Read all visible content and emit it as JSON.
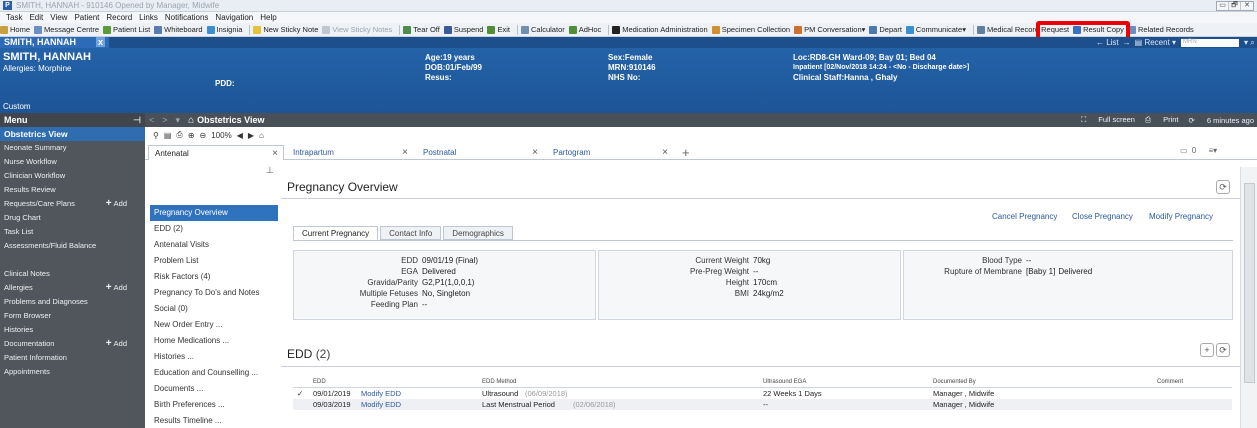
{
  "window": {
    "title": "SMITH, HANNAH - 910146 Opened by Manager, Midwife",
    "app_letter": "P",
    "controls": [
      "▭",
      "🗗",
      "✕"
    ]
  },
  "menubar": [
    "Task",
    "Edit",
    "View",
    "Patient",
    "Record",
    "Links",
    "Notifications",
    "Navigation",
    "Help"
  ],
  "toolbar": [
    {
      "label": "Home",
      "icon": "home-icon",
      "color": "#c8a040"
    },
    {
      "label": "Message Centre",
      "icon": "message-icon",
      "color": "#6a8fc0"
    },
    {
      "label": "Patient List",
      "icon": "patient-list-icon",
      "color": "#5b9a3a"
    },
    {
      "label": "Whiteboard",
      "icon": "whiteboard-icon",
      "color": "#5b7ab0"
    },
    {
      "label": "Insignia",
      "icon": "insignia-icon",
      "color": "#3a8fd0"
    },
    {
      "label": "New Sticky Note",
      "icon": "sticky-note-icon",
      "color": "#e6c23a"
    },
    {
      "label": "View Sticky Notes",
      "icon": "view-sticky-icon",
      "color": "#bfc6d0",
      "disabled": true
    },
    {
      "label": "Tear Off",
      "icon": "tear-off-icon",
      "color": "#4b8d4b"
    },
    {
      "label": "Suspend",
      "icon": "suspend-icon",
      "color": "#3b5a9a"
    },
    {
      "label": "Exit",
      "icon": "exit-icon",
      "color": "#4f8f3a"
    },
    {
      "label": "Calculator",
      "icon": "calculator-icon",
      "color": "#7090b0"
    },
    {
      "label": "AdHoc",
      "icon": "adhoc-icon",
      "color": "#4f8f3a"
    },
    {
      "label": "Medication Administration",
      "icon": "medication-icon",
      "color": "#222222"
    },
    {
      "label": "Specimen Collection",
      "icon": "specimen-icon",
      "color": "#d09030"
    },
    {
      "label": "PM Conversation",
      "icon": "pm-conversation-icon",
      "color": "#d07030",
      "dropdown": true
    },
    {
      "label": "Depart",
      "icon": "depart-icon",
      "color": "#4a7ab0"
    },
    {
      "label": "Communicate",
      "icon": "communicate-icon",
      "color": "#3a8fd0",
      "dropdown": true
    },
    {
      "label": "Medical Record Request",
      "icon": "medical-record-icon",
      "color": "#6080a0"
    },
    {
      "label": "Result Copy",
      "icon": "result-copy-icon",
      "color": "#3a70c0"
    },
    {
      "label": "Related Records",
      "icon": "related-records-icon",
      "color": "#6a8fc0"
    }
  ],
  "patient_tab": {
    "name": "SMITH, HANNAH",
    "close": "x"
  },
  "tabstrip_right": {
    "list": "List",
    "recent": "Recent",
    "mrn_placeholder": "MRN"
  },
  "banner": {
    "name": "SMITH, HANNAH",
    "allergies": "Allergies: Morphine",
    "pdd": "PDD:",
    "age": "Age:19 years",
    "dob": "DOB:01/Feb/99",
    "resus": "Resus:",
    "sex": "Sex:Female",
    "mrn": "MRN:910146",
    "nhs": "NHS No:",
    "loc": "Loc:RD8-GH Ward-09; Bay 01; Bed 04",
    "inpatient": "Inpatient [02/Nov/2018 14:24 - <No - Discharge date>]",
    "clinical_staff": "Clinical Staff:Hanna , Ghaly",
    "custom": "Custom"
  },
  "left_menu": {
    "header": "Menu",
    "items": [
      {
        "label": "Obstetrics View",
        "active": true
      },
      {
        "label": "Neonate Summary"
      },
      {
        "label": "Nurse Workflow"
      },
      {
        "label": "Clinician Workflow"
      },
      {
        "label": "Results Review"
      },
      {
        "label": "Requests/Care Plans",
        "add": "Add"
      },
      {
        "label": "Drug Chart"
      },
      {
        "label": "Task List"
      },
      {
        "label": "Assessments/Fluid Balance"
      },
      {
        "label": ""
      },
      {
        "label": "Clinical Notes"
      },
      {
        "label": "Allergies",
        "add": "Add"
      },
      {
        "label": "Problems and Diagnoses"
      },
      {
        "label": "Form Browser"
      },
      {
        "label": "Histories"
      },
      {
        "label": "Documentation",
        "add": "Add"
      },
      {
        "label": "Patient Information"
      },
      {
        "label": "Appointments"
      }
    ]
  },
  "view_bar": {
    "title": "Obstetrics View",
    "full_screen": "Full screen",
    "print": "Print",
    "refreshed": "6 minutes ago"
  },
  "sub_toolbar": {
    "zoom": "100%"
  },
  "doc_tabs": [
    {
      "label": "Antenatal",
      "selected": true
    },
    {
      "label": "Intrapartum"
    },
    {
      "label": "Postnatal"
    },
    {
      "label": "Partogram"
    }
  ],
  "doc_tabs_right": {
    "count": "0"
  },
  "left_nav": [
    {
      "label": "Pregnancy Overview",
      "selected": true
    },
    {
      "label": "EDD (2)"
    },
    {
      "label": "Antenatal Visits"
    },
    {
      "label": "Problem List"
    },
    {
      "label": "Risk Factors (4)"
    },
    {
      "label": "Pregnancy To Do's and Notes"
    },
    {
      "label": "Social (0)"
    },
    {
      "label": "New Order Entry ..."
    },
    {
      "label": "Home Medications ..."
    },
    {
      "label": "Histories ..."
    },
    {
      "label": "Education and Counselling ..."
    },
    {
      "label": "Documents ..."
    },
    {
      "label": "Birth Preferences ..."
    },
    {
      "label": "Results Timeline ..."
    }
  ],
  "pregnancy_overview": {
    "title": "Pregnancy Overview",
    "actions": [
      "Cancel Pregnancy",
      "Close Pregnancy",
      "Modify Pregnancy"
    ],
    "tabs": [
      "Current Pregnancy",
      "Contact Info",
      "Demographics"
    ],
    "box1": [
      {
        "k": "EDD",
        "v": "09/01/19 (Final)"
      },
      {
        "k": "EGA",
        "v": "Delivered"
      },
      {
        "k": "Gravida/Parity",
        "v": "G2,P1(1,0,0,1)",
        "link": true
      },
      {
        "k": "Multiple Fetuses",
        "v": "No, Singleton"
      },
      {
        "k": "Feeding Plan",
        "v": "--"
      }
    ],
    "box2": [
      {
        "k": "Current Weight",
        "v": "70kg",
        "link": true
      },
      {
        "k": "Pre-Preg Weight",
        "v": "--"
      },
      {
        "k": "Height",
        "v": "170cm"
      },
      {
        "k": "BMI",
        "v": "24kg/m2"
      }
    ],
    "box3": [
      {
        "k": "Blood Type",
        "v": "--"
      },
      {
        "k": "Rupture of Membrane",
        "v_prefix": "[Baby 1]",
        "v": "Delivered"
      }
    ]
  },
  "edd": {
    "title": "EDD",
    "count": "(2)",
    "columns": [
      "EDD",
      "EDD Method",
      "Ultrasound EGA",
      "Documented By",
      "Comment"
    ],
    "rows": [
      {
        "check": "✓",
        "edd": "09/01/2019",
        "modify": "Modify EDD",
        "method": "Ultrasound",
        "method_date": "(06/09/2018)",
        "ega": "22 Weeks 1 Days",
        "by": "Manager , Midwife",
        "comment": ""
      },
      {
        "check": "",
        "edd": "09/03/2019",
        "modify": "Modify EDD",
        "method": "Last Menstrual Period",
        "method_date": "(02/06/2018)",
        "ega": "--",
        "by": "Manager , Midwife",
        "comment": ""
      }
    ]
  }
}
